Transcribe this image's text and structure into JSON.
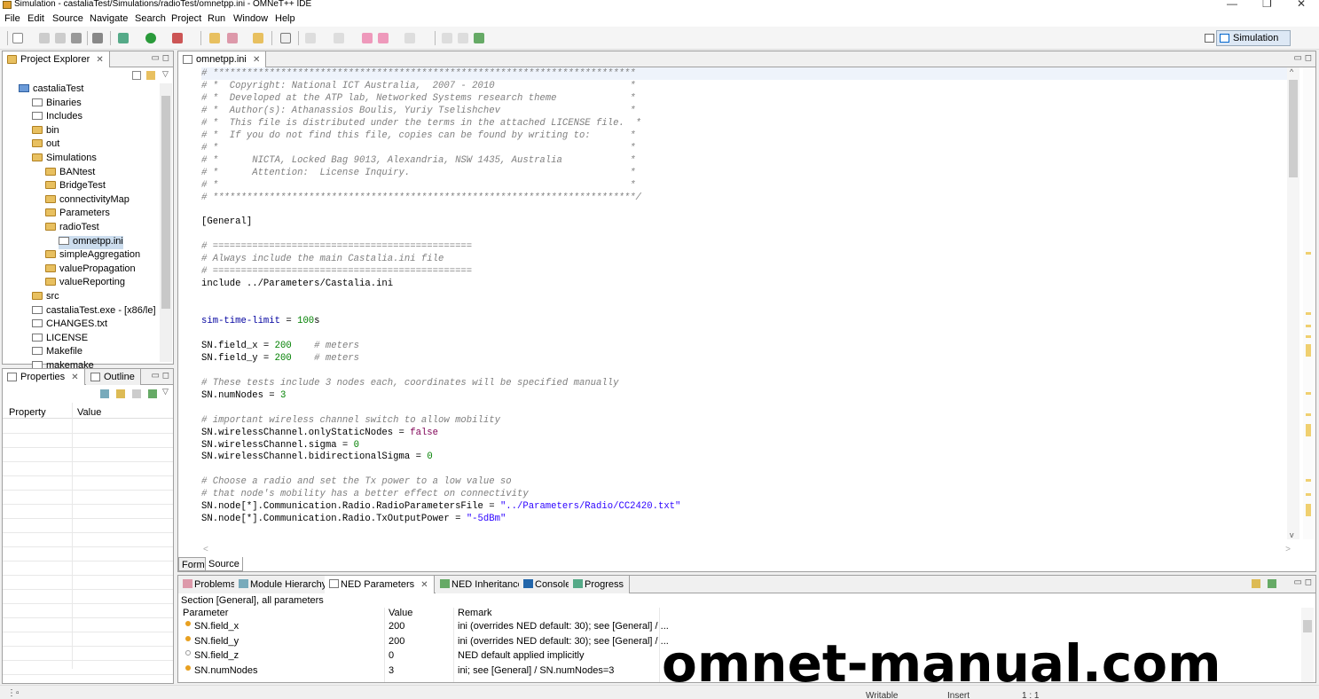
{
  "window": {
    "title": "Simulation - castaliaTest/Simulations/radioTest/omnetpp.ini - OMNeT++ IDE",
    "minimize": "—",
    "restore": "❐",
    "close": "✕"
  },
  "menu": [
    "File",
    "Edit",
    "Source",
    "Navigate",
    "Search",
    "Project",
    "Run",
    "Window",
    "Help"
  ],
  "perspective": {
    "label": "Simulation"
  },
  "project_explorer": {
    "tab_label": "Project Explorer",
    "tab_close": "✕",
    "minmax": "▭ ◻",
    "items": [
      {
        "label": "castaliaTest",
        "icon": "project-icon"
      },
      {
        "label": "Binaries",
        "icon": "binaries-icon"
      },
      {
        "label": "Includes",
        "icon": "includes-icon"
      },
      {
        "label": "bin",
        "icon": "folder-icon"
      },
      {
        "label": "out",
        "icon": "folder-icon"
      },
      {
        "label": "Simulations",
        "icon": "folder-icon"
      },
      {
        "label": "BANtest",
        "icon": "folder-icon"
      },
      {
        "label": "BridgeTest",
        "icon": "folder-icon"
      },
      {
        "label": "connectivityMap",
        "icon": "folder-icon"
      },
      {
        "label": "Parameters",
        "icon": "folder-icon"
      },
      {
        "label": "radioTest",
        "icon": "folder-icon"
      },
      {
        "label": "omnetpp.ini",
        "icon": "ini-file-icon"
      },
      {
        "label": "simpleAggregation",
        "icon": "folder-icon"
      },
      {
        "label": "valuePropagation",
        "icon": "folder-icon"
      },
      {
        "label": "valueReporting",
        "icon": "folder-icon"
      },
      {
        "label": "src",
        "icon": "folder-icon"
      },
      {
        "label": "castaliaTest.exe - [x86/le]",
        "icon": "exe-icon"
      },
      {
        "label": "CHANGES.txt",
        "icon": "file-icon"
      },
      {
        "label": "LICENSE",
        "icon": "file-icon"
      },
      {
        "label": "Makefile",
        "icon": "makefile-icon"
      },
      {
        "label": "makemake",
        "icon": "file-icon"
      }
    ]
  },
  "properties": {
    "tab_label": "Properties",
    "tab_close": "✕",
    "outline_label": "Outline",
    "minmax": "▭ ◻",
    "col_property": "Property",
    "col_value": "Value"
  },
  "editor": {
    "tab_label": "omnetpp.ini",
    "tab_close": "✕",
    "minmax": "▭ ◻",
    "form_tab": "Form",
    "source_tab": "Source",
    "hscroll_left": "<",
    "hscroll_right": ">",
    "scroll_up": "^",
    "scroll_down": "v",
    "lines": [
      {
        "t": "cm",
        "text": "# ***************************************************************************"
      },
      {
        "t": "cm",
        "text": "# *  Copyright: National ICT Australia,  2007 - 2010                        *"
      },
      {
        "t": "cm",
        "text": "# *  Developed at the ATP lab, Networked Systems research theme             *"
      },
      {
        "t": "cm",
        "text": "# *  Author(s): Athanassios Boulis, Yuriy Tselishchev                       *"
      },
      {
        "t": "cm",
        "text": "# *  This file is distributed under the terms in the attached LICENSE file.  *"
      },
      {
        "t": "cm",
        "text": "# *  If you do not find this file, copies can be found by writing to:       *"
      },
      {
        "t": "cm",
        "text": "# *                                                                         *"
      },
      {
        "t": "cm",
        "text": "# *      NICTA, Locked Bag 9013, Alexandria, NSW 1435, Australia            *"
      },
      {
        "t": "cm",
        "text": "# *      Attention:  License Inquiry.                                       *"
      },
      {
        "t": "cm",
        "text": "# *                                                                         *"
      },
      {
        "t": "cm",
        "text": "# ***************************************************************************/"
      },
      {
        "t": "blank",
        "text": ""
      },
      {
        "t": "sec",
        "text": "[General]"
      },
      {
        "t": "blank",
        "text": ""
      },
      {
        "t": "cm",
        "text": "# =============================================="
      },
      {
        "t": "cm",
        "text": "# Always include the main Castalia.ini file"
      },
      {
        "t": "cm",
        "text": "# =============================================="
      },
      {
        "t": "key",
        "text": "include ../Parameters/Castalia.ini"
      },
      {
        "t": "blank",
        "text": ""
      },
      {
        "t": "blank",
        "text": ""
      },
      {
        "t": "kv",
        "k": "sim-time-limit",
        "op": " = ",
        "v": "100",
        "vt": "num",
        "rest": "s",
        "kcls": "sim"
      },
      {
        "t": "blank",
        "text": ""
      },
      {
        "t": "kv",
        "k": "SN.field_x",
        "op": " = ",
        "v": "200",
        "vt": "num",
        "rest": "    ",
        "c": "# meters"
      },
      {
        "t": "kv",
        "k": "SN.field_y",
        "op": " = ",
        "v": "200",
        "vt": "num",
        "rest": "    ",
        "c": "# meters"
      },
      {
        "t": "blank",
        "text": ""
      },
      {
        "t": "cm",
        "text": "# These tests include 3 nodes each, coordinates will be specified manually"
      },
      {
        "t": "kv",
        "k": "SN.numNodes",
        "op": " = ",
        "v": "3",
        "vt": "num"
      },
      {
        "t": "blank",
        "text": ""
      },
      {
        "t": "cm",
        "text": "# important wireless channel switch to allow mobility"
      },
      {
        "t": "kv",
        "k": "SN.wirelessChannel.onlyStaticNodes",
        "op": " = ",
        "v": "false",
        "vt": "kw"
      },
      {
        "t": "kv",
        "k": "SN.wirelessChannel.sigma",
        "op": " = ",
        "v": "0",
        "vt": "num"
      },
      {
        "t": "kv",
        "k": "SN.wirelessChannel.bidirectionalSigma",
        "op": " = ",
        "v": "0",
        "vt": "num"
      },
      {
        "t": "blank",
        "text": ""
      },
      {
        "t": "cm",
        "text": "# Choose a radio and set the Tx power to a low value so"
      },
      {
        "t": "cm",
        "text": "# that node's mobility has a better effect on connectivity"
      },
      {
        "t": "kv",
        "k": "SN.node[*].Communication.Radio.RadioParametersFile",
        "op": " = ",
        "v": "\"../Parameters/Radio/CC2420.txt\"",
        "vt": "str"
      },
      {
        "t": "kv",
        "k": "SN.node[*].Communication.Radio.TxOutputPower",
        "op": " = ",
        "v": "\"-5dBm\"",
        "vt": "str"
      }
    ]
  },
  "bottom": {
    "tabs": [
      {
        "label": "Problems",
        "icon": "problems-icon"
      },
      {
        "label": "Module Hierarchy",
        "icon": "hierarchy-icon"
      },
      {
        "label": "NED Parameters",
        "icon": "ned-params-icon",
        "close": "✕"
      },
      {
        "label": "NED Inheritance",
        "icon": "inheritance-icon"
      },
      {
        "label": "Console",
        "icon": "console-icon"
      },
      {
        "label": "Progress",
        "icon": "progress-icon"
      }
    ],
    "minmax": "▭ ◻",
    "section": "Section [General], all parameters",
    "columns": {
      "parameter": "Parameter",
      "value": "Value",
      "remark": "Remark"
    },
    "rows": [
      {
        "param": "SN.field_x",
        "value": "200",
        "remark": "ini (overrides NED default: 30); see [General] / ...",
        "dot": "filled"
      },
      {
        "param": "SN.field_y",
        "value": "200",
        "remark": "ini (overrides NED default: 30); see [General] / ...",
        "dot": "filled"
      },
      {
        "param": "SN.field_z",
        "value": "0",
        "remark": "NED default applied implicitly",
        "dot": "hollow"
      },
      {
        "param": "SN.numNodes",
        "value": "3",
        "remark": "ini; see [General] / SN.numNodes=3",
        "dot": "filled"
      }
    ]
  },
  "status": {
    "writable": "Writable",
    "insert": "Insert",
    "position": "1 : 1"
  },
  "watermark": "omnet-manual.com"
}
